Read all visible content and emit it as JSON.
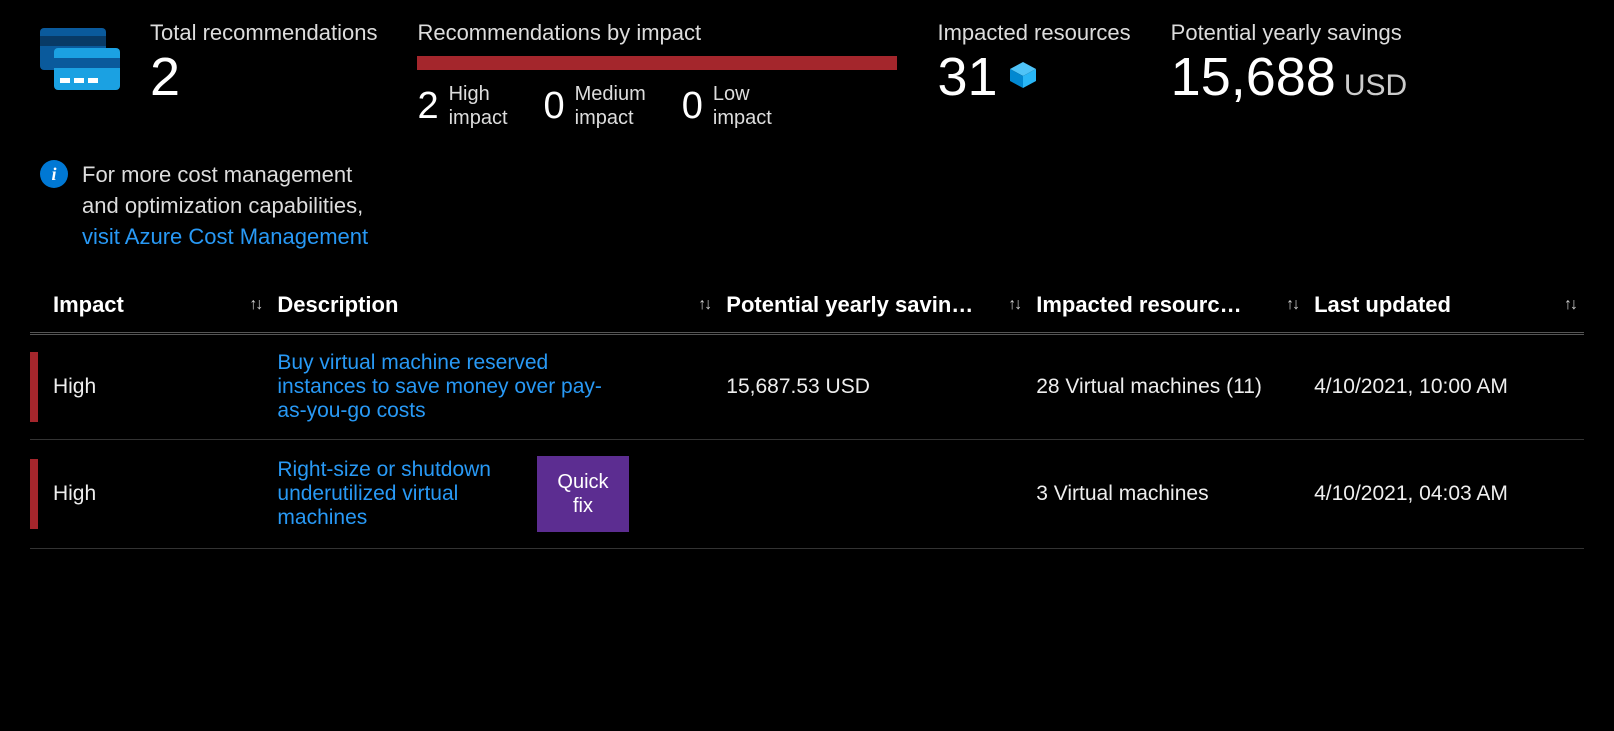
{
  "summary": {
    "total_label": "Total recommendations",
    "total_value": "2",
    "impact_label": "Recommendations by impact",
    "high_count": "2",
    "high_label": "High\nimpact",
    "medium_count": "0",
    "medium_label": "Medium\nimpact",
    "low_count": "0",
    "low_label": "Low\nimpact",
    "resources_label": "Impacted resources",
    "resources_value": "31",
    "savings_label": "Potential yearly savings",
    "savings_value": "15,688",
    "savings_currency": "USD"
  },
  "info": {
    "text_line1": "For more cost management",
    "text_line2": "and optimization capabilities,",
    "link_text": "visit Azure Cost Management"
  },
  "table": {
    "headers": {
      "impact": "Impact",
      "description": "Description",
      "savings": "Potential yearly savin…",
      "resources": "Impacted resourc…",
      "updated": "Last updated"
    },
    "rows": [
      {
        "impact": "High",
        "description": "Buy virtual machine reserved instances to save money over pay-as-you-go costs",
        "quickfix": false,
        "savings": "15,687.53 USD",
        "resources": "28 Virtual machines (11)",
        "updated": "4/10/2021, 10:00 AM",
        "impact_color": "#a4262c"
      },
      {
        "impact": "High",
        "description": "Right-size or shutdown underutilized virtual machines",
        "quickfix": true,
        "quickfix_label": "Quick fix",
        "savings": "",
        "resources": "3 Virtual machines",
        "updated": "4/10/2021, 04:03 AM",
        "impact_color": "#a4262c"
      }
    ]
  }
}
